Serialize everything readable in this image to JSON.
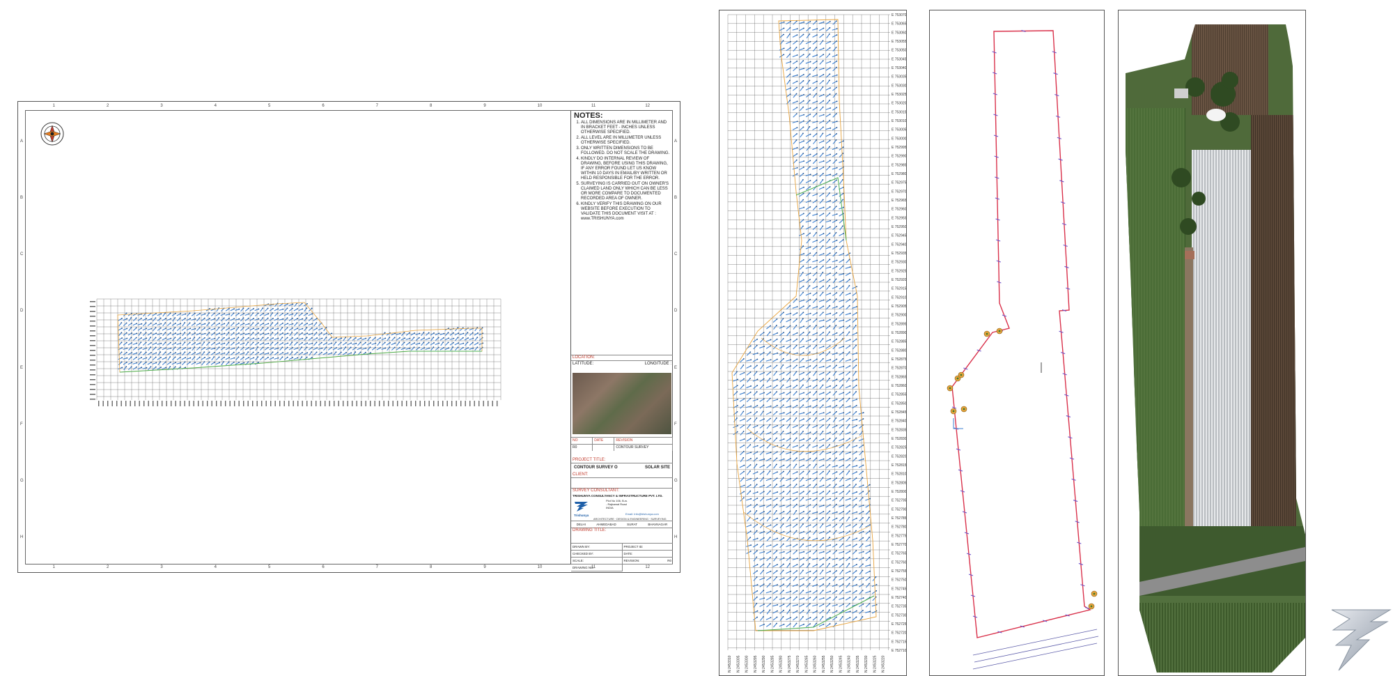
{
  "sheet1": {
    "column_numbers": [
      "1",
      "2",
      "3",
      "4",
      "5",
      "6",
      "7",
      "8",
      "9",
      "10",
      "11",
      "12"
    ],
    "row_letters": [
      "A",
      "B",
      "C",
      "D",
      "E",
      "F",
      "G",
      "H"
    ],
    "notes_title": "NOTES:",
    "notes": [
      "ALL DIMENSIONS ARE IN MILLIMETER AND IN BRACKET FEET - INCHES UNLESS OTHERWISE SPECIFIED.",
      "ALL LEVEL ARE IN MILLIMETER UNLESS OTHERWISE SPECIFIED.",
      "ONLY WRITTEN DIMENSIONS TO BE FOLLOWED. DO NOT SCALE THE DRAWING.",
      "KINDLY DO INTERNAL REVIEW OF DRAWING, BEFORE USING THIS DRAWING, IF ANY ERROR FOUND LET US KNOW WITHIN 10 DAYS IN EMAIL/BY WRITTEN OR HELD RESPONSIBLE FOR THE ERROR.",
      "SURVEYING IS CARRIED OUT ON OWNER'S CLAIMED LAND ONLY WHICH CAN BE LESS OR MORE COMPARE TO DOCUMENTED RECORDED AREA OF OWNER.",
      "KINDLY VERIFY THIS DRAWING ON OUR WEBSITE BEFORE EXECUTION TO VALIDATE THIS DOCUMENT VISIT AT : www.TRISHUNYA.com"
    ],
    "location_label": "LOCATION:",
    "latitude_label": "LATITUDE:",
    "longitude_label": "LONGITUDE :",
    "rev_headers": [
      "NO",
      "DATE",
      "REVISION"
    ],
    "rev_row": [
      "R0",
      "",
      "CONTOUR SURVEY"
    ],
    "project_title_label": "PROJECT TITLE:",
    "project_title": "CONTOUR SURVEY O",
    "project_site": "SOLAR SITE",
    "client_label": "CLIENT:",
    "consultant_label": "SURVEY CONSULTANT:",
    "consultant_name": "TRISHUNYA CONSULTANCY & INFRASTRUCTURE PVT. LTD.",
    "consultant_addr": [
      "Plot No 106, B-w.",
      "- Rajkamal Road",
      "INDIA"
    ],
    "consultant_email": "Email: Info@trishunya.com",
    "logo_text": "Trishunya",
    "services": "ARCHITECTURE · DESIGN & ENGINEERING · SURVEYING",
    "offices": [
      "DELHI",
      "AHMEDABAD",
      "SURAT",
      "BHAVNAGAR"
    ],
    "drawing_title_label": "DRAWING TITLE:",
    "sig_left": [
      "DRAWN BY:",
      "CHECKED BY:",
      "SCALE:",
      "DRAWING NO:"
    ],
    "sig_right": [
      "PROJECT ID:",
      "DATE:",
      "REVISION:"
    ],
    "revision_val": "R0"
  },
  "sheet2": {
    "northing_prefix": "E",
    "northing_labels": [
      "753070",
      "753065",
      "753060",
      "753055",
      "753050",
      "753045",
      "753040",
      "753035",
      "753030",
      "753025",
      "753020",
      "753015",
      "753010",
      "753005",
      "753000",
      "752995",
      "752990",
      "752985",
      "752980",
      "752975",
      "752970",
      "752965",
      "752960",
      "752955",
      "752950",
      "752945",
      "752940",
      "752935",
      "752930",
      "752925",
      "752920",
      "752915",
      "752910",
      "752905",
      "752900",
      "752895",
      "752890",
      "752885",
      "752880",
      "752875",
      "752870",
      "752865",
      "752860",
      "752855",
      "752850",
      "752845",
      "752840",
      "752835",
      "752830",
      "752825",
      "752820",
      "752815",
      "752810",
      "752805",
      "752800",
      "752795",
      "752790",
      "752785",
      "752780",
      "752775",
      "752770",
      "752765",
      "752760",
      "752755",
      "752750",
      "752745",
      "752740",
      "752735",
      "752730",
      "752725",
      "752720",
      "752715",
      "752710"
    ],
    "easting_labels": [
      "N 2453310",
      "N 2453305",
      "N 2453300",
      "N 2453295",
      "N 2453290",
      "N 2453285",
      "N 2453280",
      "N 2453275",
      "N 2453270",
      "N 2453265",
      "N 2453260",
      "N 2453255",
      "N 2453250",
      "N 2453245",
      "N 2453240",
      "N 2453235",
      "N 2453230",
      "N 2453225",
      "N 2453220"
    ]
  },
  "colors": {
    "boundary_red": "#d9304a",
    "contour_orange": "#e8a33c",
    "contour_green": "#4caf50",
    "arrow_blue": "#3b7fd0",
    "grid": "#555555"
  },
  "icons": [
    "north-compass-icon",
    "trishunya-logo-icon"
  ]
}
